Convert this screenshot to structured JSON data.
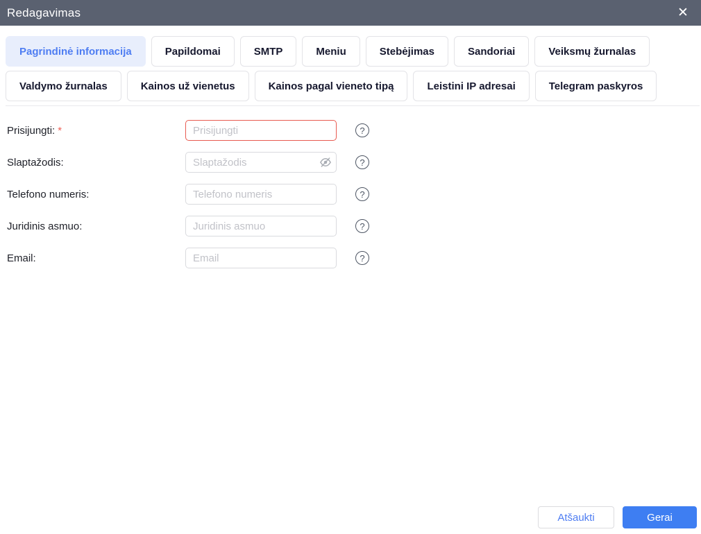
{
  "dialog": {
    "title": "Redagavimas"
  },
  "icons": {
    "close": "✕",
    "help": "?"
  },
  "tabs": {
    "rows": [
      [
        {
          "label": "Pagrindinė informacija",
          "active": true
        },
        {
          "label": "Papildomai",
          "active": false
        },
        {
          "label": "SMTP",
          "active": false
        },
        {
          "label": "Meniu",
          "active": false
        },
        {
          "label": "Stebėjimas",
          "active": false
        },
        {
          "label": "Sandoriai",
          "active": false
        },
        {
          "label": "Veiksmų žurnalas",
          "active": false
        }
      ],
      [
        {
          "label": "Valdymo žurnalas",
          "active": false
        },
        {
          "label": "Kainos už vienetus",
          "active": false
        },
        {
          "label": "Kainos pagal vieneto tipą",
          "active": false
        },
        {
          "label": "Leistini IP adresai",
          "active": false
        },
        {
          "label": "Telegram paskyros",
          "active": false
        }
      ]
    ]
  },
  "form": {
    "required_marker": "*",
    "fields": [
      {
        "id": "prisijungti",
        "label": "Prisijungti:",
        "required": true,
        "placeholder": "Prisijungti",
        "value": "",
        "error": true,
        "password_toggle": false
      },
      {
        "id": "slaptazodis",
        "label": "Slaptažodis:",
        "required": false,
        "placeholder": "Slaptažodis",
        "value": "",
        "error": false,
        "password_toggle": true
      },
      {
        "id": "telefono-numeris",
        "label": "Telefono numeris:",
        "required": false,
        "placeholder": "Telefono numeris",
        "value": "",
        "error": false,
        "password_toggle": false
      },
      {
        "id": "juridinis-asmuo",
        "label": "Juridinis asmuo:",
        "required": false,
        "placeholder": "Juridinis asmuo",
        "value": "",
        "error": false,
        "password_toggle": false
      },
      {
        "id": "email",
        "label": "Email:",
        "required": false,
        "placeholder": "Email",
        "value": "",
        "error": false,
        "password_toggle": false
      }
    ]
  },
  "footer": {
    "cancel_label": "Atšaukti",
    "ok_label": "Gerai"
  },
  "colors": {
    "header_bg": "#5a6170",
    "accent_blue": "#3e7ef2",
    "active_tab_bg": "#e8eefc",
    "active_tab_text": "#4e7df2",
    "error_border": "#e85a50",
    "required_red": "#ee6156"
  }
}
